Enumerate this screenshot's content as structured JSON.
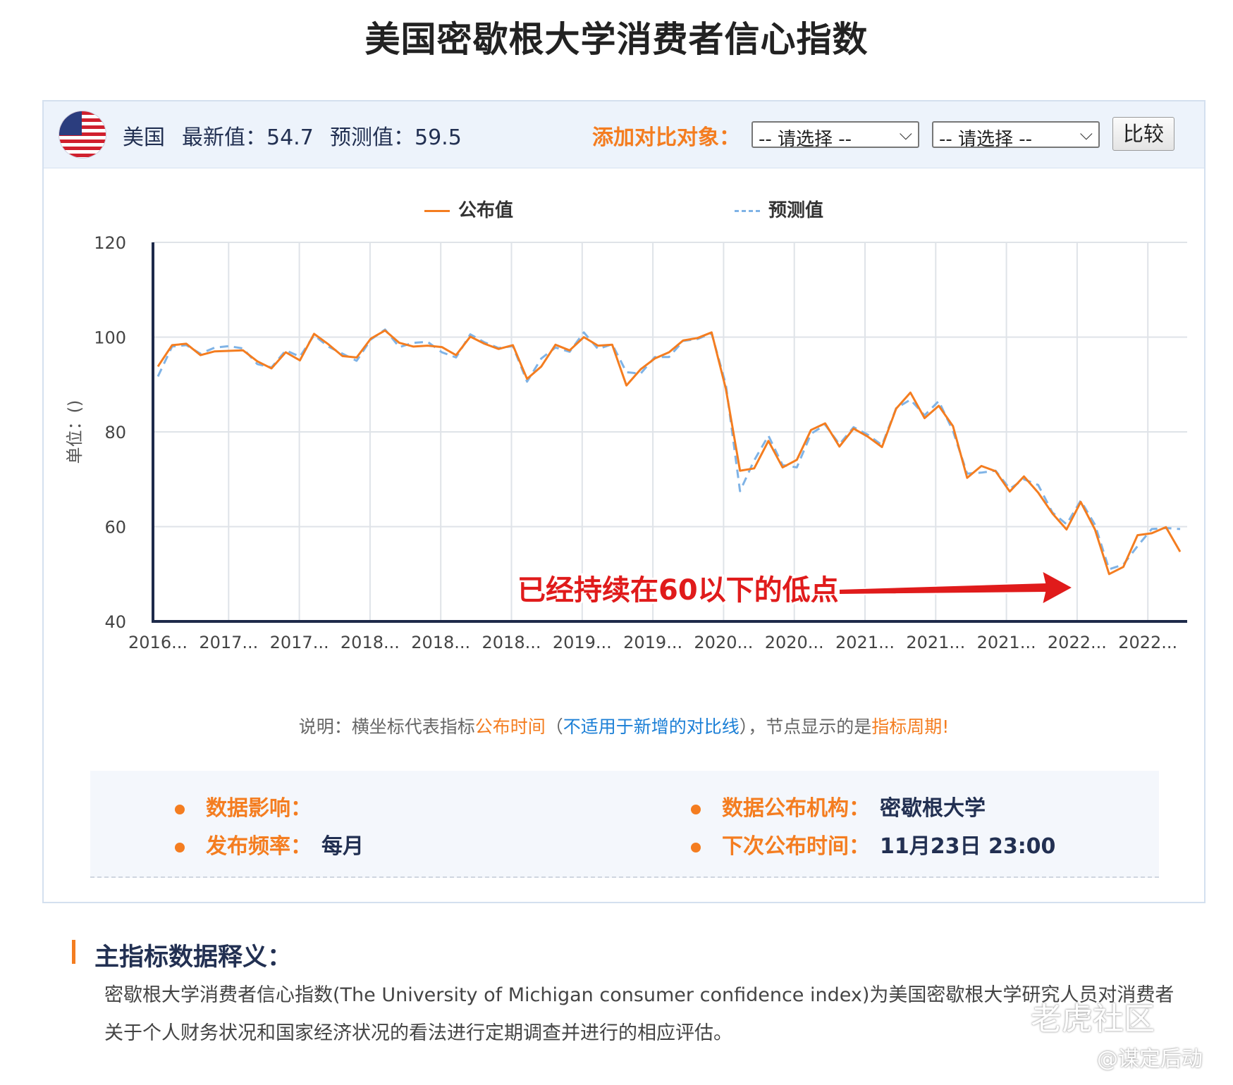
{
  "page_title": "美国密歇根大学消费者信心指数",
  "header": {
    "country": "美国",
    "latest": "最新值：54.7",
    "forecast": "预测值：59.5",
    "add_compare": "添加对比对象：",
    "select1": "-- 请选择 --",
    "select2": "-- 请选择 --",
    "compare_button": "比较"
  },
  "legend": {
    "published": "公布值",
    "forecast": "预测值"
  },
  "note": {
    "p1": "说明：横坐标代表指标",
    "p2": "公布时间",
    "p3": "（",
    "p4": "不适用于新增的对比线",
    "p5": "），节点显示的是",
    "p6": "指标周期",
    "p7": "!"
  },
  "info": {
    "impact_label": "数据影响：",
    "impact_value": "",
    "freq_label": "发布频率：",
    "freq_value": "每月",
    "org_label": "数据公布机构：",
    "org_value": "密歇根大学",
    "next_label": "下次公布时间：",
    "next_value": "11月23日 23:00"
  },
  "section": {
    "title": "主指标数据释义：",
    "desc": "密歇根大学消费者信心指数(The University of Michigan consumer confidence index)为美国密歇根大学研究人员对消费者关于个人财务状况和国家经济状况的看法进行定期调查并进行的相应评估。"
  },
  "watermark": {
    "main": "老虎社区",
    "sub": "@谋定后动"
  },
  "colors": {
    "published": "#f47d20",
    "forecast": "#7fb3e6",
    "axis": "#1e2a4a",
    "annotation": "#e01b1b"
  },
  "chart_data": {
    "type": "line",
    "ylabel": "单位：()",
    "ylim": [
      40,
      120
    ],
    "yticks": [
      40,
      60,
      80,
      100,
      120
    ],
    "xtick_labels": [
      "2016...",
      "2017...",
      "2017...",
      "2018...",
      "2018...",
      "2018...",
      "2019...",
      "2019...",
      "2020...",
      "2020...",
      "2021...",
      "2021...",
      "2021...",
      "2022...",
      "2022..."
    ],
    "annotation": "已经持续在60以下的低点",
    "series": [
      {
        "name": "公布值",
        "values": [
          93.8,
          98.3,
          98.6,
          96.2,
          97.0,
          97.1,
          97.2,
          94.9,
          93.4,
          96.8,
          95.1,
          100.7,
          98.5,
          96.0,
          95.7,
          99.7,
          101.4,
          98.8,
          98.0,
          98.2,
          97.9,
          96.2,
          100.1,
          98.6,
          97.5,
          98.3,
          91.2,
          93.8,
          98.4,
          97.2,
          100.0,
          98.2,
          98.4,
          89.8,
          93.2,
          95.5,
          96.8,
          99.3,
          99.8,
          101.0,
          89.1,
          71.8,
          72.3,
          78.1,
          72.5,
          74.1,
          80.4,
          81.8,
          76.9,
          80.7,
          79.0,
          76.8,
          84.9,
          88.3,
          82.9,
          85.5,
          81.2,
          70.3,
          72.8,
          71.7,
          67.4,
          70.6,
          67.2,
          62.8,
          59.4,
          65.2,
          59.4,
          50.0,
          51.5,
          58.2,
          58.6,
          59.9,
          54.7
        ]
      },
      {
        "name": "预测值",
        "values": [
          91.7,
          98.0,
          98.3,
          96.5,
          97.8,
          98.1,
          97.6,
          94.3,
          93.6,
          97.2,
          95.9,
          100.4,
          98.0,
          96.5,
          95.0,
          99.5,
          101.6,
          97.9,
          98.8,
          99.0,
          96.8,
          95.7,
          100.6,
          98.9,
          97.7,
          98.1,
          90.6,
          95.5,
          97.8,
          96.9,
          101.0,
          97.5,
          98.5,
          92.6,
          92.3,
          95.8,
          95.8,
          99.2,
          99.6,
          100.8,
          90.0,
          67.5,
          74.0,
          79.2,
          73.0,
          72.5,
          79.6,
          81.5,
          77.4,
          81.0,
          79.4,
          77.2,
          85.0,
          86.8,
          83.5,
          86.5,
          80.2,
          71.2,
          71.4,
          71.8,
          68.0,
          70.0,
          68.8,
          63.0,
          60.5,
          65.5,
          60.4,
          51.0,
          52.0,
          55.9,
          59.5,
          59.7,
          59.5
        ]
      }
    ]
  }
}
